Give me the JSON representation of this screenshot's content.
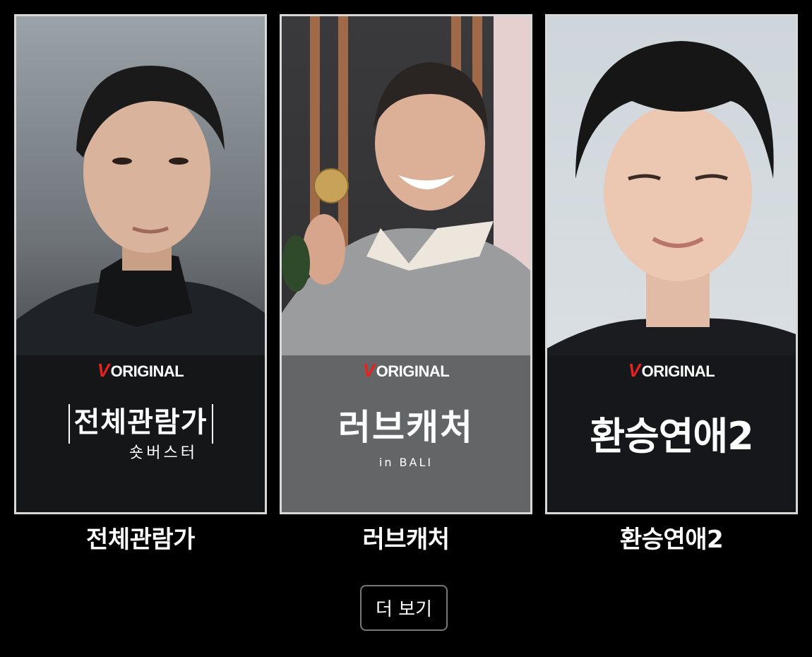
{
  "cards": [
    {
      "badge_brand": "V",
      "badge_text": "ORIGINAL",
      "logo": "전체관람가",
      "logo_sub": "숏버스터",
      "title": "전체관람가"
    },
    {
      "badge_brand": "V",
      "badge_text": "ORIGINAL",
      "logo": "러브캐처",
      "logo_sub": "in BALI",
      "title": "러브캐처"
    },
    {
      "badge_brand": "V",
      "badge_text": "ORIGINAL",
      "logo": "환승연애2",
      "title": "환승연애2"
    }
  ],
  "more_button": "더 보기",
  "colors": {
    "background": "#000000",
    "poster_border": "#d8d8d8",
    "badge_accent": "#e8231f",
    "button_border": "#777777"
  }
}
